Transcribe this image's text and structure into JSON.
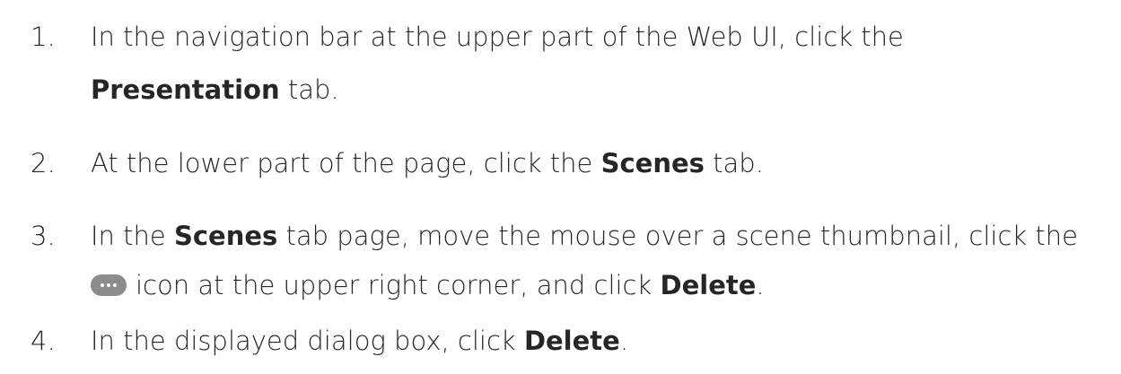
{
  "steps": [
    {
      "number": "1.",
      "lines": [
        {
          "text": "In the navigation bar at the upper part of the Web UI, click the"
        },
        {
          "bold": "Presentation",
          "after": " tab."
        }
      ]
    },
    {
      "number": "2.",
      "before": "At the lower part of the page, click the ",
      "bold": "Scenes",
      "after": " tab."
    },
    {
      "number": "3.",
      "line1_before": "In the ",
      "line1_bold": "Scenes",
      "line1_after": " tab page, move the mouse over a scene thumbnail, click the",
      "line2_icon": "more-options-icon",
      "line2_text": "icon at the upper right corner, and click ",
      "line2_bold": "Delete",
      "line2_after": "."
    },
    {
      "number": "4.",
      "before": "In the displayed dialog box, click ",
      "bold": "Delete",
      "after": "."
    }
  ]
}
